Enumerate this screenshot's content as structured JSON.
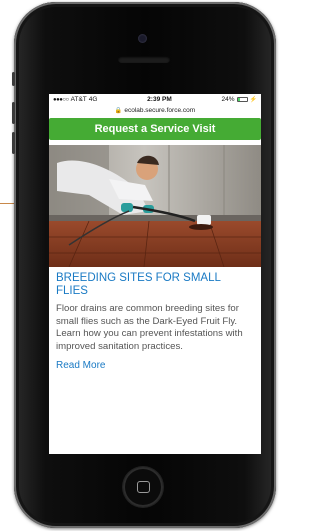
{
  "status_bar": {
    "carrier": "AT&T",
    "network": "4G",
    "time": "2:39 PM",
    "battery_percent": "24%",
    "battery_level": 0.24
  },
  "browser": {
    "url": "ecolab.secure.force.com"
  },
  "cta": {
    "label": "Request a Service Visit"
  },
  "article": {
    "title_line1": "BREEDING SITES FOR SMALL",
    "title_line2": "FLIES",
    "body": "Floor drains are common breeding sites for small flies such as the Dark-Eyed Fruit Fly. Learn how you can prevent infestations with improved sanitation practices.",
    "read_more": "Read More"
  },
  "colors": {
    "accent_green": "#45ab34",
    "link_blue": "#1a7ac4",
    "annotation_line": "#c8884a"
  },
  "icons": [
    "lock-icon",
    "battery-icon",
    "charging-icon",
    "signal-icon",
    "home-button-icon"
  ]
}
